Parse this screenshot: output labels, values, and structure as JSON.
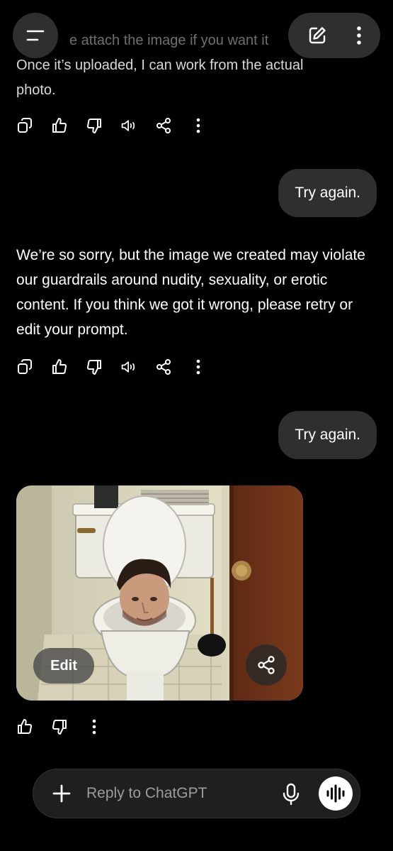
{
  "header": {
    "prev_line1": "e attach the image if you want it",
    "prev_line2": "Once it’s uploaded, I can work from the actual",
    "prev_line3": "photo.",
    "menu_icon": "menu-icon",
    "new_chat_icon": "edit-icon",
    "more_icon": "more-vertical-icon"
  },
  "messages": {
    "user_1": "Try again.",
    "assistant_1": "We’re so sorry, but the image we created may violate our guardrails around nudity, sexuality, or erotic content. If you think we got it wrong, please retry or edit your prompt.",
    "user_2": "Try again.",
    "image_edit_label": "Edit"
  },
  "composer": {
    "placeholder": "Reply to ChatGPT"
  },
  "colors": {
    "background": "#000000",
    "bubble": "#2f2f2f",
    "composer": "#1f1f1f"
  }
}
